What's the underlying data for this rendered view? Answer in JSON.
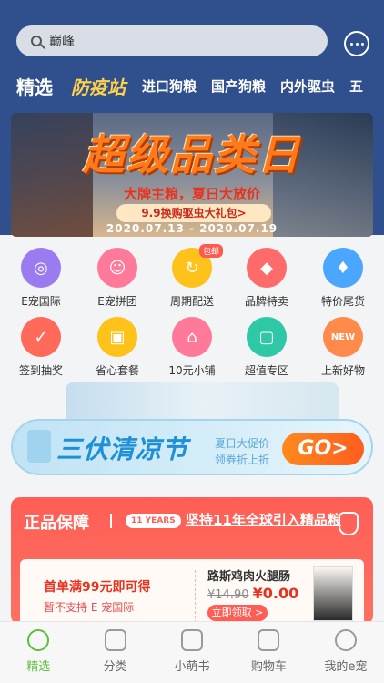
{
  "search": {
    "placeholder": "巅峰"
  },
  "categories": {
    "active": "精选",
    "logo": "防疫站",
    "items": [
      "进口狗粮",
      "国产狗粮",
      "内外驱虫",
      "五"
    ]
  },
  "banner": {
    "title": "超级品类日",
    "subtitle": "大牌主粮，夏日大放价",
    "pill": "9.9换购驱虫大礼包>",
    "date": "2020.07.13 - 2020.07.19"
  },
  "grid": [
    {
      "label": "E宠国际",
      "icon": "globe-icon",
      "color": "#9a7cf0"
    },
    {
      "label": "E宠拼团",
      "icon": "group-icon",
      "color": "#ff7a9a"
    },
    {
      "label": "周期配送",
      "icon": "cycle-icon",
      "color": "#ffc21a",
      "badge": "包邮"
    },
    {
      "label": "品牌特卖",
      "icon": "tag-icon",
      "color": "#ff6b6b"
    },
    {
      "label": "特价尾货",
      "icon": "flame-icon",
      "color": "#4aa6ff"
    },
    {
      "label": "签到抽奖",
      "icon": "calendar-icon",
      "color": "#ff6a5a"
    },
    {
      "label": "省心套餐",
      "icon": "box-icon",
      "color": "#ffc21a"
    },
    {
      "label": "10元小铺",
      "icon": "shop-icon",
      "color": "#ff7a9a"
    },
    {
      "label": "超值专区",
      "icon": "bag-icon",
      "color": "#2ec8a6"
    },
    {
      "label": "上新好物",
      "icon": "new-icon",
      "color": "#ff8a4a",
      "icon_text": "NEW"
    }
  ],
  "promo": {
    "title": "三伏清凉节",
    "sub1": "夏日大促价",
    "sub2": "领券折上折",
    "go": "GO>"
  },
  "guarantee": {
    "title": "正品保障",
    "years": "11 YEARS",
    "slogan": "坚持11年全球引入精品粮",
    "coupon": {
      "left_title": "首单满99元即可得",
      "left_note": "暂不支持 E 宠国际",
      "right_title": "路斯鸡肉火腿肠",
      "old_price": "¥14.90",
      "new_price": "¥0.00",
      "button": "立即领取 >"
    }
  },
  "tabbar": [
    {
      "label": "精选",
      "active": true
    },
    {
      "label": "分类",
      "active": false
    },
    {
      "label": "小萌书",
      "active": false
    },
    {
      "label": "购物车",
      "active": false
    },
    {
      "label": "我的e宠",
      "active": false
    }
  ]
}
